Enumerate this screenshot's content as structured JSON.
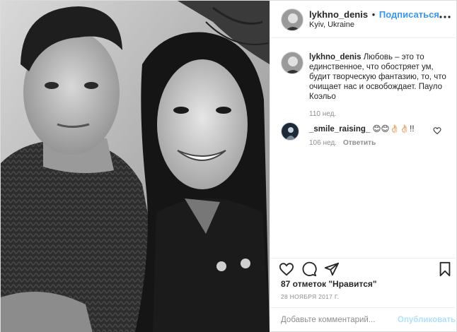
{
  "header": {
    "username": "lykhno_denis",
    "separator": "•",
    "follow_label": "Подписаться",
    "location": "Kyiv, Ukraine",
    "more_icon": "more-icon"
  },
  "caption": {
    "username": "lykhno_denis",
    "text": "Любовь – это то единственное, что обостряет ум, будит творческую фантазию, то, что очищает нас и освобождает. Пауло Коэльо",
    "time": "110 нед."
  },
  "comments": [
    {
      "username": "_smile_raising_",
      "text": "😊😊👌🏻👌🏻!!",
      "time": "106 нед.",
      "reply_label": "Ответить"
    }
  ],
  "actions": {
    "like_icon": "heart-icon",
    "comment_icon": "comment-icon",
    "share_icon": "share-icon",
    "save_icon": "bookmark-icon"
  },
  "likes": "87 отметок \"Нравится\"",
  "date": "28 НОЯБРЯ 2017 Г.",
  "add_comment": {
    "placeholder": "Добавьте комментарий...",
    "submit_label": "Опубликовать"
  }
}
